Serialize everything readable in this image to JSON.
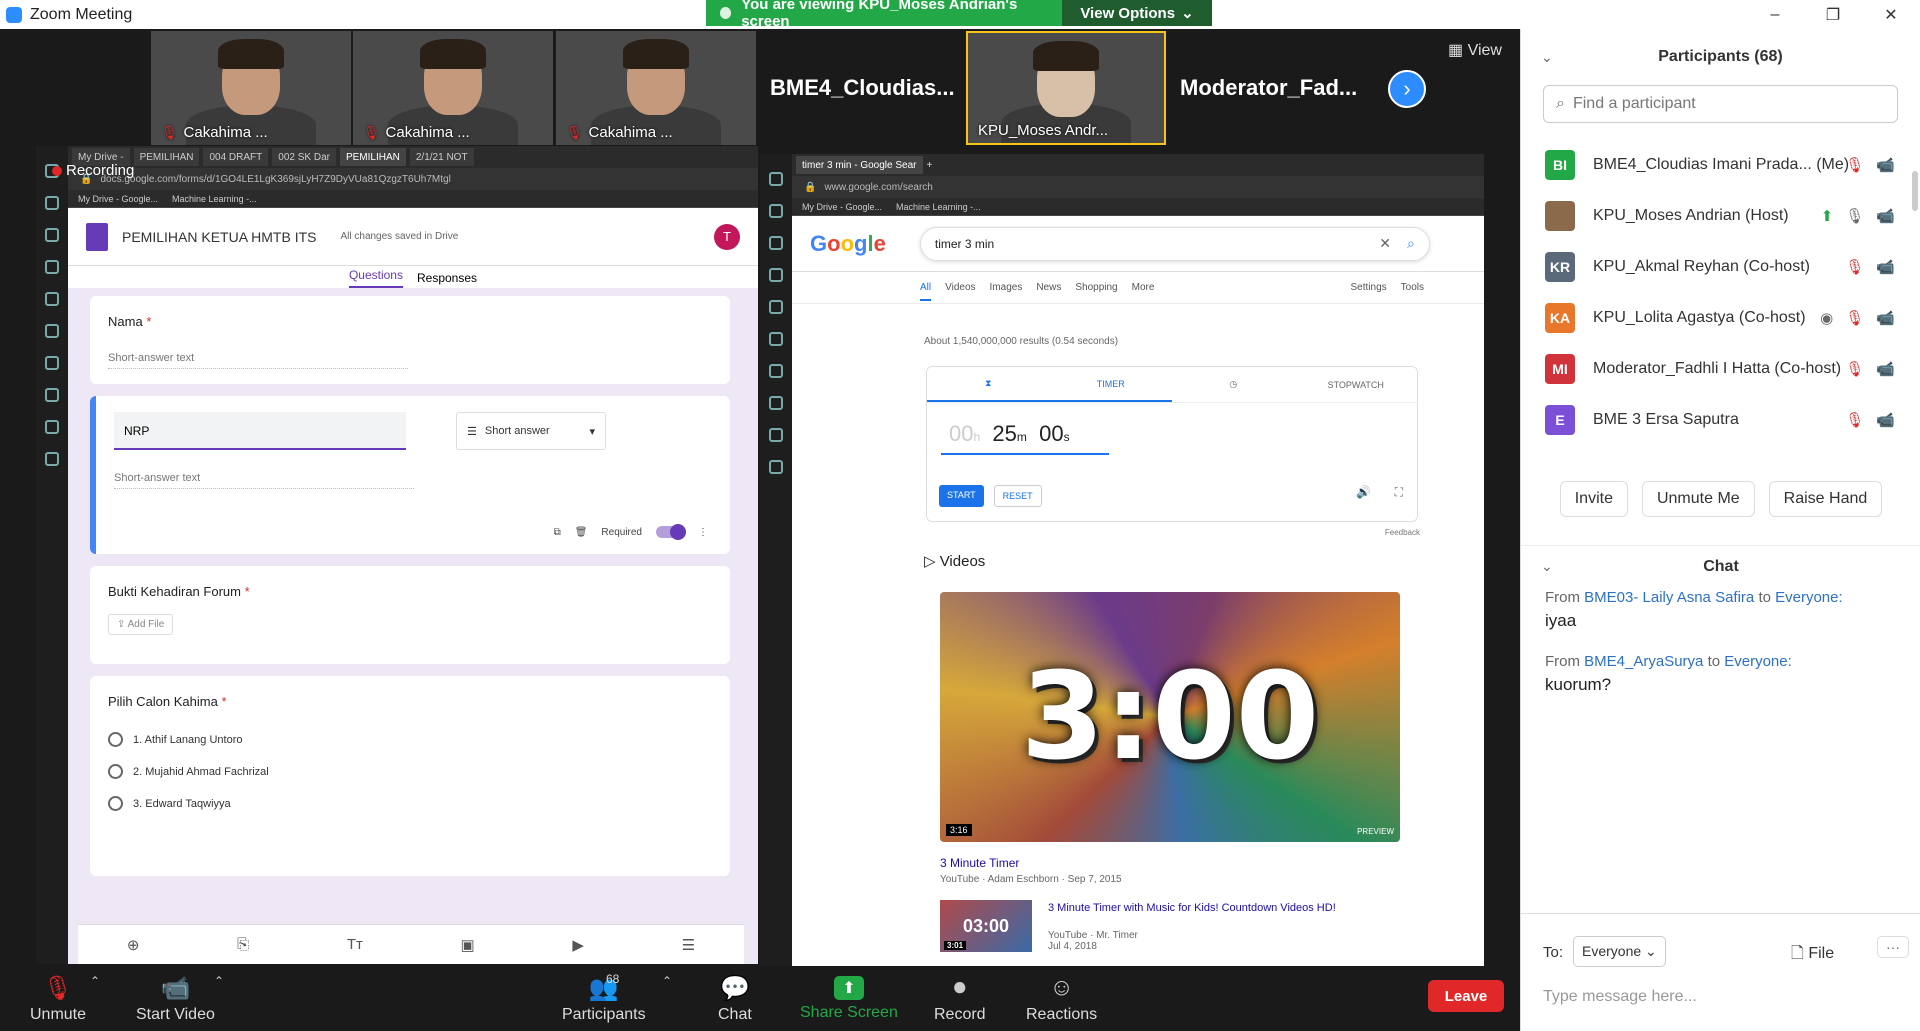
{
  "window": {
    "title": "Zoom Meeting",
    "share_banner": "You are viewing KPU_Moses Andrian's screen",
    "view_options": "View Options",
    "view_label": "View"
  },
  "video_strip": {
    "tiles": [
      {
        "name": "Cakahima ..."
      },
      {
        "name": "Cakahima ..."
      },
      {
        "name": "Cakahima ..."
      }
    ],
    "name_tiles": [
      {
        "name": "BME4_Cloudias..."
      },
      {
        "name": "Moderator_Fad..."
      }
    ],
    "active_tile": {
      "name": "KPU_Moses Andr..."
    }
  },
  "recording_label": "Recording",
  "browser_left": {
    "tabs": [
      "My Drive -",
      "PEMILIHAN",
      "004 DRAFT",
      "002 SK Dar",
      "PEMILIHAN",
      "2/1/21 NOT"
    ],
    "url": "docs.google.com/forms/d/1GO4LE1LgK369sjLyH7Z9DyVUa81QzgzT6Uh7Mtgl",
    "bookmarks": [
      "My Drive - Google...",
      "Machine Learning -..."
    ],
    "form_title": "PEMILIHAN KETUA HMTB ITS",
    "saved": "All changes saved in Drive",
    "avatar": "T",
    "tabs_form": [
      "Questions",
      "Responses"
    ],
    "q1": "Nama",
    "q1_ph": "Short-answer text",
    "q2": "NRP",
    "q2_type": "Short answer",
    "q2_ph": "Short-answer text",
    "required": "Required",
    "q3": "Bukti Kehadiran Forum",
    "add_file": "Add File",
    "q4": "Pilih Calon Kahima",
    "options": [
      "1. Athif Lanang Untoro",
      "2. Mujahid Ahmad Fachrizal",
      "3. Edward Taqwiyya"
    ]
  },
  "browser_right": {
    "tab": "timer 3 min - Google Sear",
    "url": "www.google.com/search",
    "bookmarks": [
      "My Drive - Google...",
      "Machine Learning -..."
    ],
    "query": "timer 3 min",
    "nav": [
      "All",
      "Videos",
      "Images",
      "News",
      "Shopping",
      "More",
      "Settings",
      "Tools"
    ],
    "results": "About 1,540,000,000 results (0.54 seconds)",
    "timer_tab": "TIMER",
    "stopwatch_tab": "STOPWATCH",
    "hours": "00",
    "minutes": "25",
    "seconds": "00",
    "start": "START",
    "reset": "RESET",
    "feedback": "Feedback",
    "videos_head": "Videos",
    "video1_big": "3:00",
    "video1_dur": "3:16",
    "video1_preview": "PREVIEW",
    "video1_title": "3 Minute Timer",
    "video1_meta": "YouTube · Adam Eschborn · Sep 7, 2015",
    "video2_big": "03:00",
    "video2_dur": "3:01",
    "video2_title": "3 Minute Timer with Music for Kids! Countdown Videos HD!",
    "video2_meta": "YouTube · Mr. Timer",
    "video2_date": "Jul 4, 2018"
  },
  "toolbar": {
    "unmute": "Unmute",
    "start_video": "Start Video",
    "participants": "Participants",
    "participants_count": "68",
    "chat": "Chat",
    "share_screen": "Share Screen",
    "record": "Record",
    "reactions": "Reactions",
    "leave": "Leave"
  },
  "panel": {
    "title": "Participants (68)",
    "find_placeholder": "Find a participant",
    "participants": [
      {
        "initials": "BI",
        "color": "#23a847",
        "name": "BME4_Cloudias Imani Prada... (Me)"
      },
      {
        "initials": "",
        "color": "#8a6a4a",
        "name": "KPU_Moses Andrian (Host)"
      },
      {
        "initials": "KR",
        "color": "#5a6a7a",
        "name": "KPU_Akmal Reyhan (Co-host)"
      },
      {
        "initials": "KA",
        "color": "#e8762b",
        "name": "KPU_Lolita Agastya (Co-host)"
      },
      {
        "initials": "MI",
        "color": "#d0343a",
        "name": "Moderator_Fadhli I Hatta (Co-host)"
      },
      {
        "initials": "E",
        "color": "#7b4fd6",
        "name": "BME 3 Ersa Saputra"
      }
    ],
    "buttons": [
      "Invite",
      "Unmute Me",
      "Raise Hand"
    ],
    "chat_title": "Chat",
    "messages": [
      {
        "from_label": "From",
        "sender": "BME03- Laily Asna Safira",
        "to_label": "to",
        "target": "Everyone:",
        "text": "iyaa"
      },
      {
        "from_label": "From",
        "sender": "BME4_AryaSurya",
        "to_label": "to",
        "target": "Everyone:",
        "text": "kuorum?"
      }
    ],
    "to_label": "To:",
    "to_value": "Everyone",
    "file_label": "File",
    "input_placeholder": "Type message here..."
  }
}
